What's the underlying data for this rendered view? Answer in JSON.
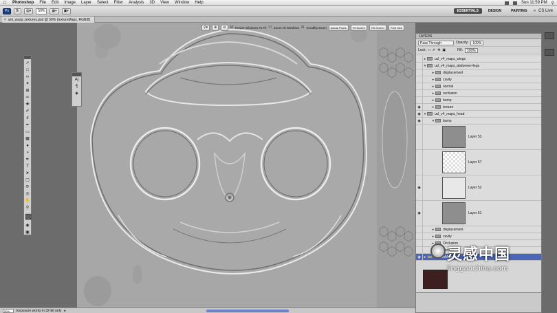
{
  "menubar": {
    "app": "Photoshop",
    "items": [
      "File",
      "Edit",
      "Image",
      "Layer",
      "Select",
      "Filter",
      "Analysis",
      "3D",
      "View",
      "Window",
      "Help"
    ],
    "clock": "Sun 11:59 PM",
    "user": "CS Live"
  },
  "options": {
    "zoom": "50%",
    "checks": [
      "Resize Windows To Fit",
      "Zoom All Windows",
      "Scrubby Zoom"
    ],
    "buttons": [
      "Actual Pixels",
      "Fit Screen",
      "Fill Screen",
      "Print Size"
    ],
    "workspaces": [
      "ESSENTIALS",
      "DESIGN",
      "PAINTING"
    ]
  },
  "document": {
    "tab": "ant_wasp_textures.psd @ 50% (textureMaps, RGB/8)"
  },
  "status": {
    "zoom": "50%",
    "text": "Exposure works in 32-bit only"
  },
  "layers_panel": {
    "tab": "LAYERS",
    "blend_mode": "Pass Through",
    "opacity_label": "Opacity:",
    "opacity": "100%",
    "lock_label": "Lock:",
    "fill_label": "Fill:",
    "fill": "100%",
    "groups": [
      {
        "name": "ucl_v4_maps_wings",
        "visible": false,
        "indent": 0
      },
      {
        "name": "ucl_v4_maps_abdomen+legs",
        "visible": false,
        "indent": 0
      },
      {
        "name": "displacement",
        "visible": false,
        "indent": 1
      },
      {
        "name": "cavity",
        "visible": false,
        "indent": 1
      },
      {
        "name": "normal",
        "visible": false,
        "indent": 1
      },
      {
        "name": "occlusion",
        "visible": false,
        "indent": 1
      },
      {
        "name": "bump",
        "visible": false,
        "indent": 1
      },
      {
        "name": "texture",
        "visible": true,
        "indent": 1
      },
      {
        "name": "ucl_v4_maps_head",
        "visible": true,
        "indent": 0
      },
      {
        "name": "bump",
        "visible": true,
        "indent": 1
      }
    ],
    "layers": [
      {
        "name": "Layer 53",
        "visible": false
      },
      {
        "name": "Layer 57",
        "visible": false
      },
      {
        "name": "Layer 52",
        "visible": true
      },
      {
        "name": "Layer 51",
        "visible": true
      }
    ],
    "groups_after": [
      {
        "name": "displacement",
        "visible": false
      },
      {
        "name": "cavity",
        "visible": false
      },
      {
        "name": "Occlusion",
        "visible": false
      },
      {
        "name": "normal",
        "visible": false
      },
      {
        "name": "textureMaps",
        "visible": true,
        "selected": true
      }
    ]
  },
  "watermark": {
    "title": "灵感中国",
    "url": "lingganchina.com"
  }
}
